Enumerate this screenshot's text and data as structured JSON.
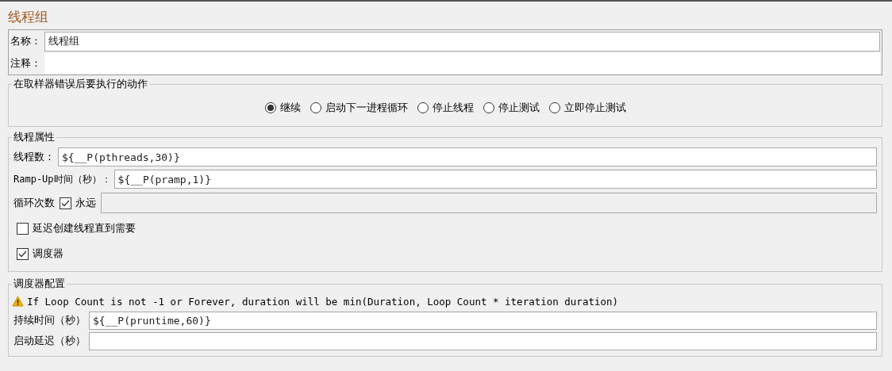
{
  "title": "线程组",
  "name_field": {
    "label": "名称：",
    "value": "线程组"
  },
  "comment_field": {
    "label": "注释："
  },
  "error_action": {
    "legend": "在取样器错误后要执行的动作",
    "options": [
      {
        "label": "继续",
        "selected": true
      },
      {
        "label": "启动下一进程循环",
        "selected": false
      },
      {
        "label": "停止线程",
        "selected": false
      },
      {
        "label": "停止测试",
        "selected": false
      },
      {
        "label": "立即停止测试",
        "selected": false
      }
    ]
  },
  "thread_properties": {
    "legend": "线程属性",
    "threads": {
      "label": "线程数：",
      "value": "${__P(pthreads,30)}"
    },
    "ramp_up": {
      "label": "Ramp-Up时间（秒）：",
      "value": "${__P(pramp,1)}"
    },
    "loop": {
      "label": "循环次数",
      "forever_label": "永远",
      "forever_checked": true
    },
    "delay_create": {
      "label": "延迟创建线程直到需要",
      "checked": false
    },
    "scheduler": {
      "label": "调度器",
      "checked": true
    }
  },
  "scheduler_config": {
    "legend": "调度器配置",
    "warning": "If Loop Count is not -1 or Forever, duration will be min(Duration, Loop Count * iteration duration)",
    "duration": {
      "label": "持续时间（秒）",
      "value": "${__P(pruntime,60)}"
    },
    "startup_delay": {
      "label": "启动延迟（秒）"
    }
  }
}
